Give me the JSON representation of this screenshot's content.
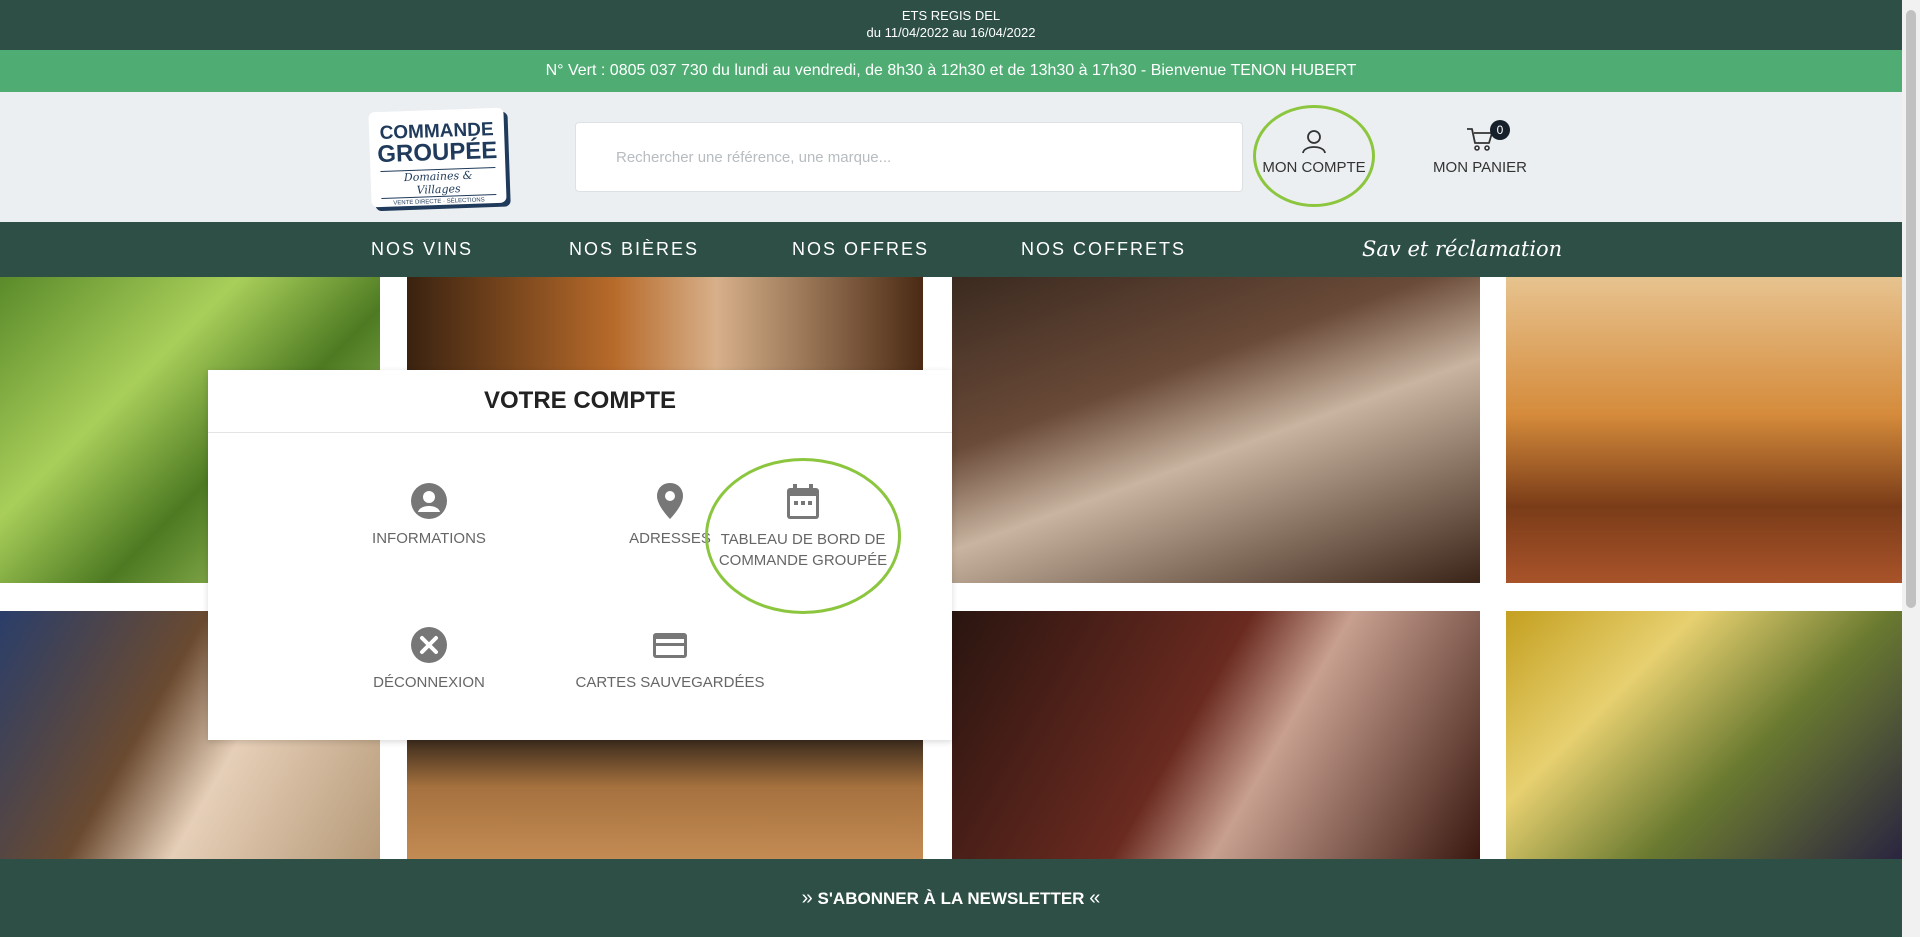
{
  "topbar": {
    "line1": "ETS REGIS DEL",
    "line2": "du 11/04/2022 au 16/04/2022"
  },
  "infobar": {
    "text": "N° Vert : 0805 037 730 du lundi au vendredi, de 8h30 à 12h30 et de 13h30 à 17h30 - Bienvenue TENON HUBERT"
  },
  "logo": {
    "line1": "COMMANDE",
    "line2": "GROUPÉE",
    "line3": "Domaines & Villages",
    "line4": "VENTE DIRECTE · SÉLECTIONS"
  },
  "search": {
    "placeholder": "Rechercher une référence, une marque..."
  },
  "account": {
    "label": "MON COMPTE"
  },
  "cart": {
    "label": "MON PANIER",
    "count": "0"
  },
  "nav": {
    "items": [
      "NOS VINS",
      "NOS BIÈRES",
      "NOS OFFRES",
      "NOS COFFRETS"
    ],
    "sav": "Sav et réclamation"
  },
  "account_panel": {
    "title": "VOTRE COMPTE",
    "tiles": [
      {
        "label": "INFORMATIONS",
        "icon": "user-circle-icon"
      },
      {
        "label": "ADRESSES",
        "icon": "location-pin-icon"
      },
      {
        "label": "TABLEAU DE BORD DE COMMANDE GROUPÉE",
        "icon": "calendar-icon"
      },
      {
        "label": "DÉCONNEXION",
        "icon": "close-circle-icon"
      },
      {
        "label": "CARTES SAUVEGARDÉES",
        "icon": "credit-card-icon"
      }
    ]
  },
  "newsletter": {
    "label": "S'ABONNER À LA NEWSLETTER",
    "left_chev": "»",
    "right_chev": "«"
  },
  "colors": {
    "dark_green": "#2d4f45",
    "light_green": "#4fad74",
    "highlight": "#8cc63f"
  }
}
